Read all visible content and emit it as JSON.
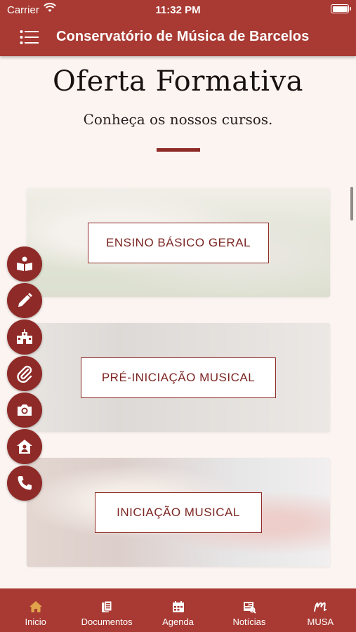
{
  "status_bar": {
    "carrier": "Carrier",
    "time": "11:32 PM"
  },
  "header": {
    "title": "Conservatório de Música de Barcelos"
  },
  "hero": {
    "title": "Oferta Formativa",
    "subtitle": "Conheça os nossos cursos."
  },
  "courses": [
    {
      "label": "ENSINO BÁSICO GERAL"
    },
    {
      "label": "PRÉ-INICIAÇÃO MUSICAL"
    },
    {
      "label": "INICIAÇÃO MUSICAL"
    }
  ],
  "quick_menu": [
    {
      "icon": "book-reader-icon"
    },
    {
      "icon": "pencil-icon"
    },
    {
      "icon": "school-icon"
    },
    {
      "icon": "paperclip-icon"
    },
    {
      "icon": "camera-icon"
    },
    {
      "icon": "home-user-icon"
    },
    {
      "icon": "phone-icon"
    }
  ],
  "tabbar": [
    {
      "label": "Inicio",
      "icon": "home-icon",
      "active": true
    },
    {
      "label": "Documentos",
      "icon": "documents-icon",
      "active": false
    },
    {
      "label": "Agenda",
      "icon": "calendar-icon",
      "active": false
    },
    {
      "label": "Notícias",
      "icon": "news-icon",
      "active": false
    },
    {
      "label": "MUSA",
      "icon": "musa-logo-icon",
      "active": false
    }
  ],
  "colors": {
    "primary": "#a83a33",
    "accent_dark": "#8e2a27",
    "active_tab": "#e0a24a",
    "background": "#fbf4f1"
  }
}
